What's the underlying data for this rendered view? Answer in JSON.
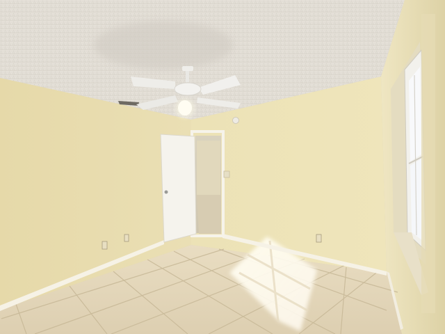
{
  "scene": {
    "kind": "empty-bedroom-interior",
    "colors": {
      "ceiling": "#e9e5dd",
      "ceiling_shadow": "#d6d1c8",
      "left_wall": "#e8dcae",
      "back_wall": "#efe4b8",
      "right_wall": "#ebdfb2",
      "floor_tile": "#e6d9bc",
      "grout": "#c9bb9c",
      "baseboard": "#f6f2e6",
      "door": "#f4f2ec",
      "window_light": "#f7f8fa",
      "fan_white": "#f2f2f0",
      "sunlight": "#fffbea"
    },
    "objects": [
      "ceiling-fan-with-light",
      "textured-ceiling",
      "open-interior-door",
      "hallway",
      "window-with-sunlight",
      "ceramic-tile-floor",
      "baseboards",
      "electrical-outlets",
      "light-switch",
      "smoke-detector",
      "air-vent"
    ]
  }
}
